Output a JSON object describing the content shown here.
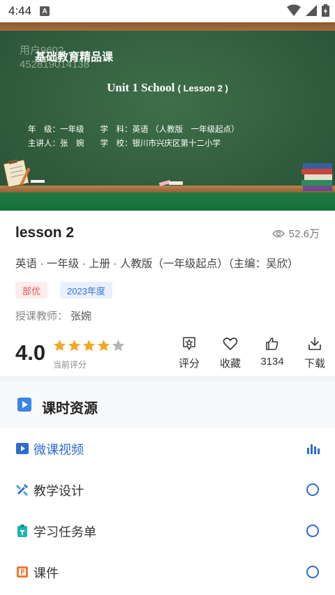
{
  "status_bar": {
    "time": "4:44",
    "notification_icon": "A"
  },
  "video": {
    "watermark_user": "用户9602",
    "watermark_id": "452819014138",
    "brand": "基础教育精品课",
    "title_main": "Unit 1 School",
    "title_sub": "( Lesson 2 )",
    "info_line1": "年　级：一年级　　学　科：英语 （人教版　一年级起点）",
    "info_line2": "主讲人：张　婉　　学　校：银川市兴庆区第十二小学"
  },
  "course": {
    "title": "lesson 2",
    "views": "52.6万",
    "subtitle": "英语 · 一年级 · 上册 · 人教版（一年级起点）（主编：吴欣）",
    "tags": [
      "部优",
      "2023年度"
    ],
    "teacher_label": "授课教师：",
    "teacher_name": "张婉",
    "rating": "4.0",
    "rating_value": 4,
    "rating_max": 5,
    "rating_label": "当前评分"
  },
  "actions": {
    "rate": "评分",
    "favorite": "收藏",
    "likes": "3134",
    "download": "下载"
  },
  "resources": {
    "header": "课时资源",
    "items": [
      {
        "label": "微课视频",
        "icon": "play-square-icon",
        "status": "playing"
      },
      {
        "label": "教学设计",
        "icon": "design-tools-icon",
        "status": "circle"
      },
      {
        "label": "学习任务单",
        "icon": "clipboard-icon",
        "status": "circle"
      },
      {
        "label": "课件",
        "icon": "ppt-file-icon",
        "status": "circle"
      }
    ]
  },
  "colors": {
    "accent_blue": "#2d6bd2",
    "star_orange": "#f5a623",
    "tag_red": "#e05a55",
    "chalkboard": "#2f5a3b"
  }
}
